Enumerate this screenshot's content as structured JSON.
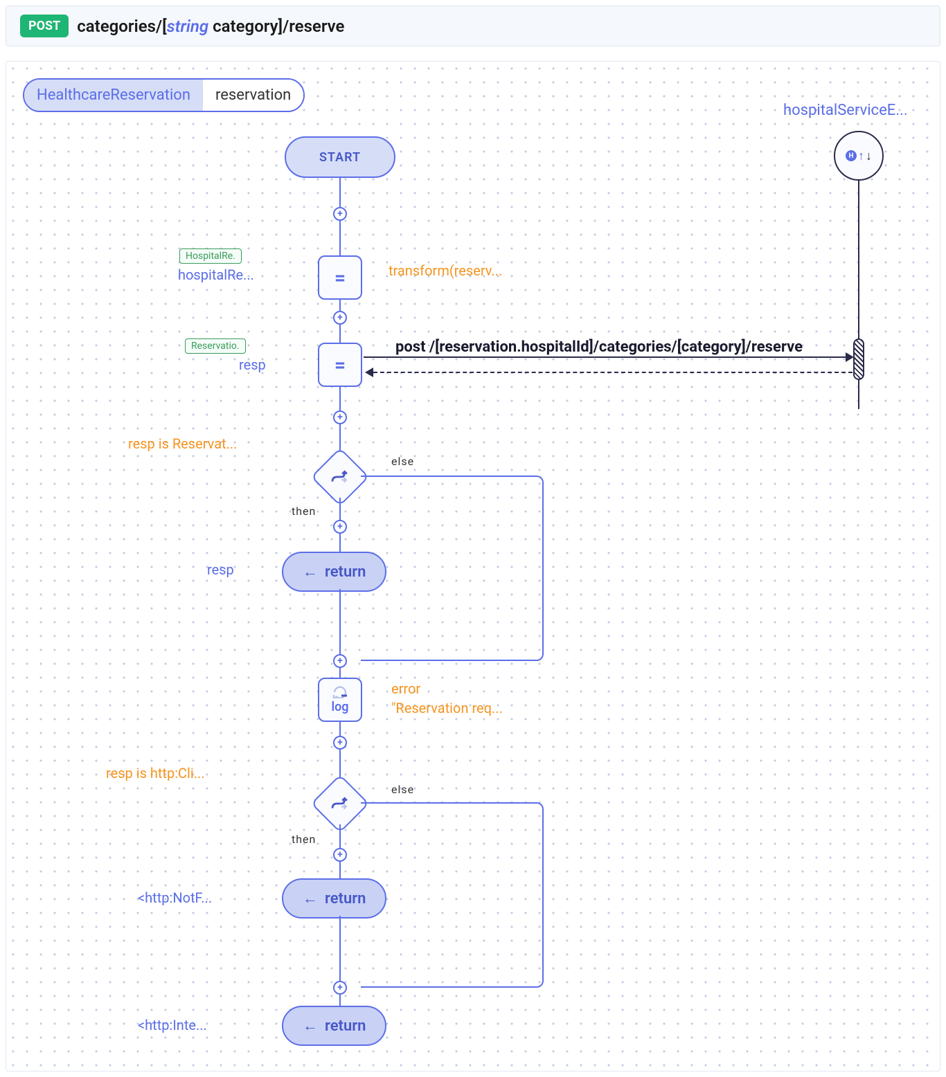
{
  "header": {
    "method": "POST",
    "path_prefix": "categories/[",
    "param_type": "string",
    "param_name": " category",
    "path_suffix": "]/reserve"
  },
  "input_pill": {
    "type": "HealthcareReservation",
    "name": "reservation"
  },
  "endpoint_label": "hospitalServiceE...",
  "nodes": {
    "start": "START",
    "assign1": {
      "op": "=",
      "type_tag": "HospitalRe.",
      "var": "hospitalRe...",
      "expr": "transform(reserv..."
    },
    "assign2": {
      "op": "=",
      "type_tag": "Reservatio.",
      "var": "resp",
      "call": "post /[reservation.hospitalId]/categories/[category]/reserve"
    },
    "branch1": {
      "cond": "resp is Reservat...",
      "then": "then",
      "else": "else"
    },
    "return1": {
      "label": "return",
      "value": "resp"
    },
    "log": {
      "name": "log",
      "arg1": "error",
      "arg2": "\"Reservation req..."
    },
    "branch2": {
      "cond": "resp is http:Cli...",
      "then": "then",
      "else": "else"
    },
    "return2": {
      "label": "return",
      "value": "<http:NotF..."
    },
    "return3": {
      "label": "return",
      "value": "<http:Inte..."
    }
  }
}
